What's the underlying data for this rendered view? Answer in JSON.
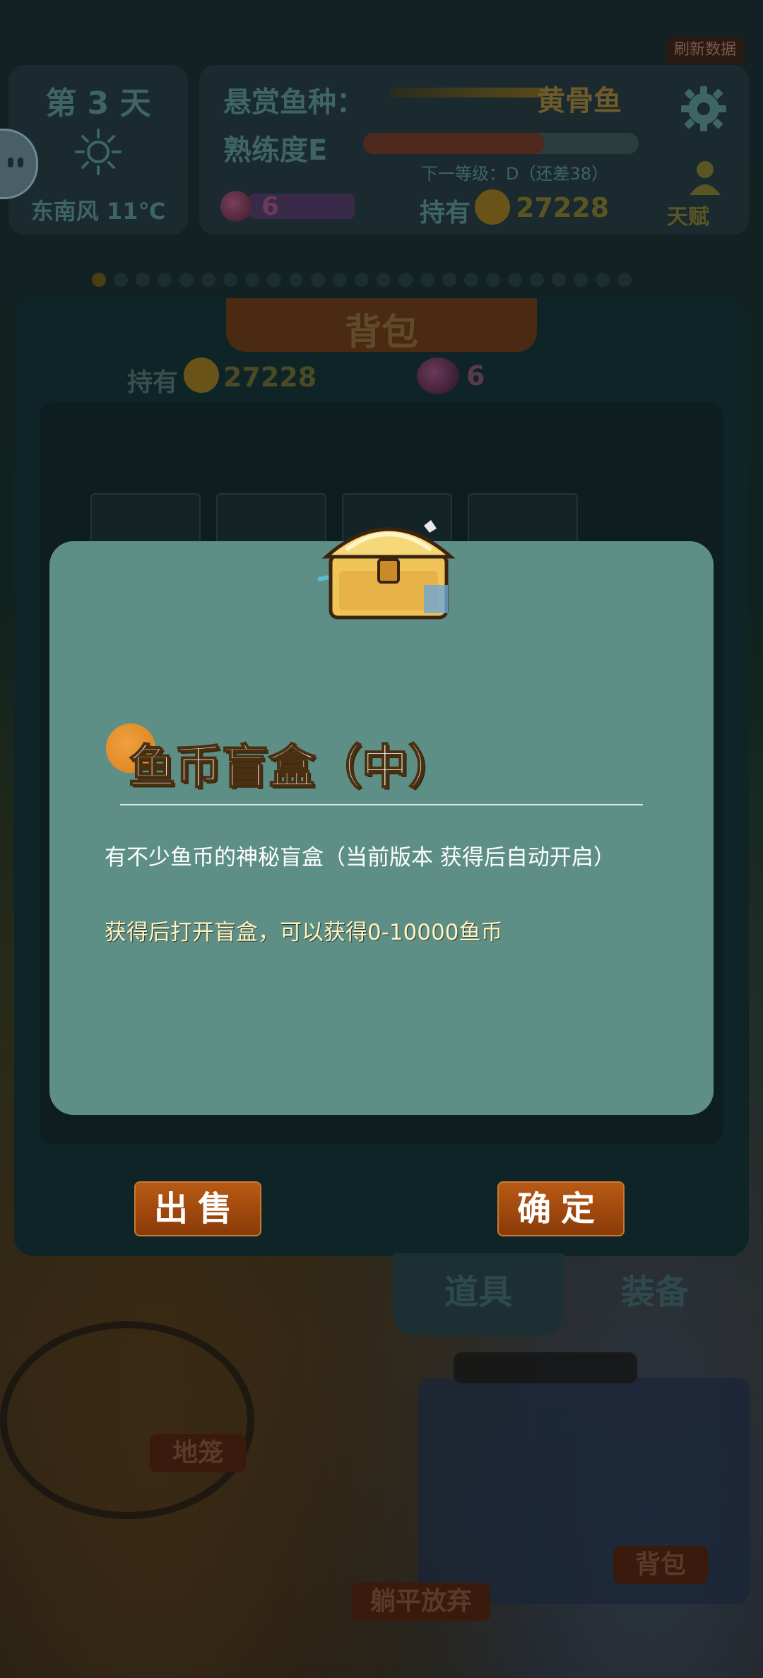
{
  "hud": {
    "day": "第 3 天",
    "wind": "东南风 11℃",
    "bounty_label": "悬赏鱼种：",
    "bounty_fish": "黄骨鱼",
    "proficiency_label": "熟练度E",
    "proficiency_progress": 0.66,
    "next_level": "下一等级：D（还差38）",
    "gems": "6",
    "own_label": "持有",
    "coins": "27228",
    "talent": "天赋",
    "refresh": "刷新数据"
  },
  "backpack": {
    "title": "背包",
    "own_label": "持有",
    "coins": "27228",
    "gems": "6",
    "sell_label": "出售",
    "confirm_label": "确定",
    "tabs": [
      "道具",
      "装备"
    ]
  },
  "scene": {
    "ground_cage": "地笼",
    "bag_label": "背包",
    "give_up": "躺平放弃"
  },
  "modal": {
    "title": "鱼币盲盒（中）",
    "description": "有不少鱼币的神秘盲盒（当前版本 获得后自动开启）",
    "reward": "获得后打开盲盒，可以获得0-10000鱼币"
  },
  "colors": {
    "modal_bg": "#5e8f86",
    "button": "#a34c0f",
    "accent_orange": "#e8901f"
  }
}
